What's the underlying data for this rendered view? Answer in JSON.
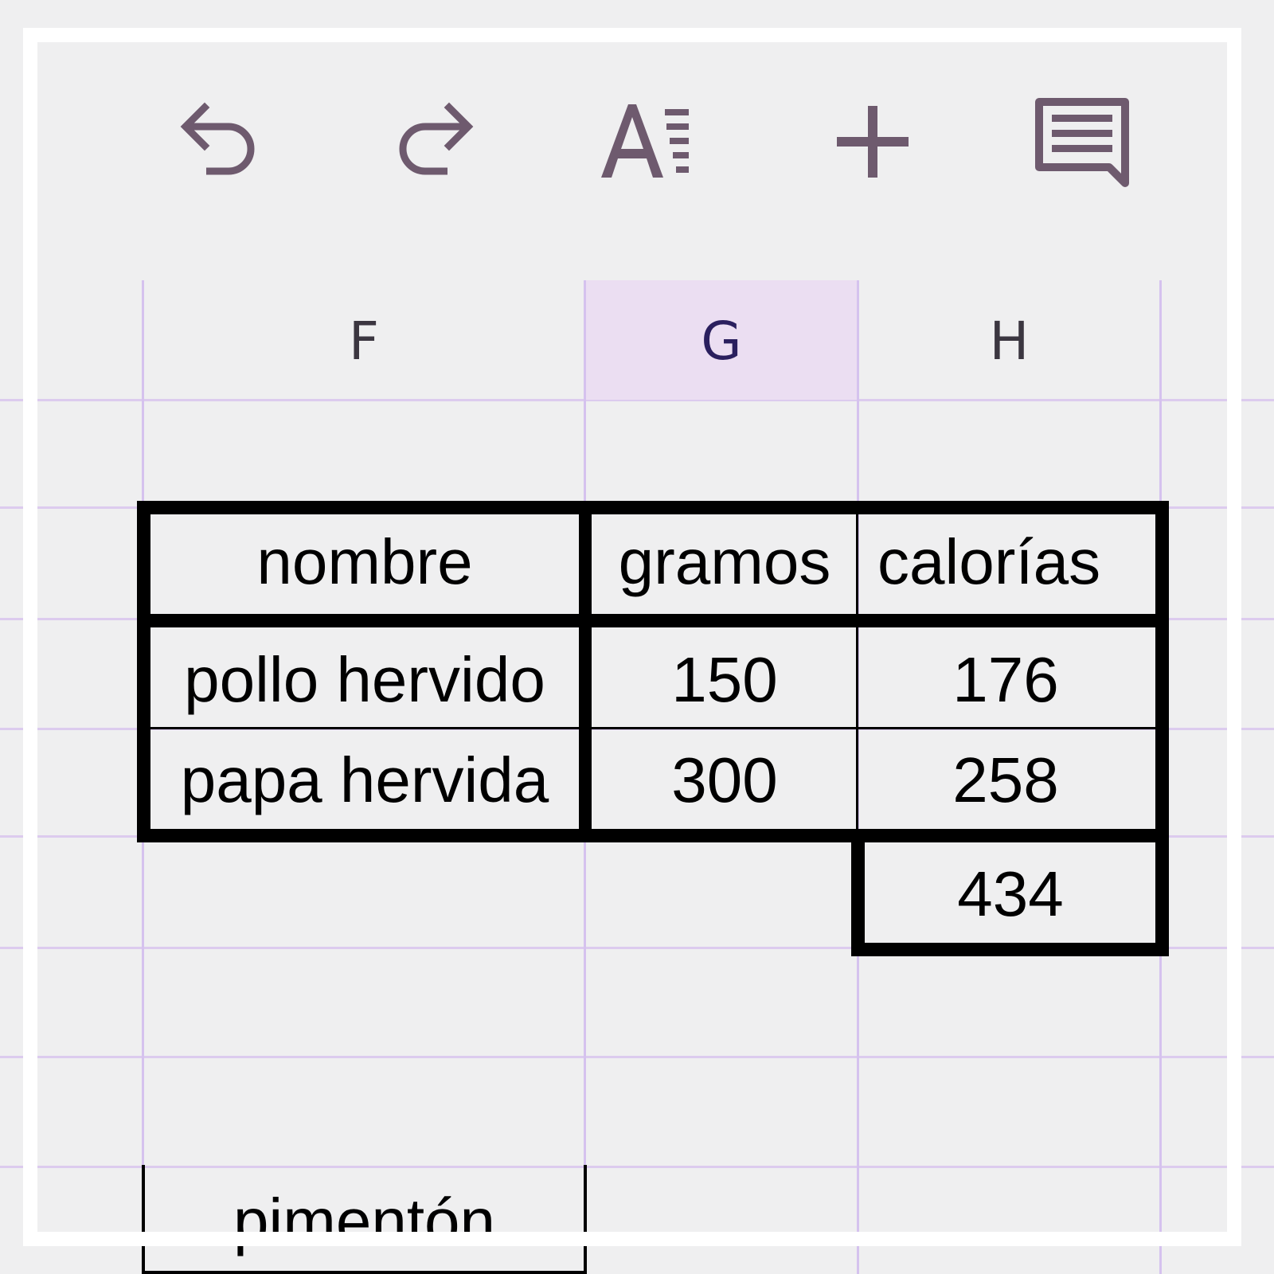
{
  "toolbar": {
    "undo_icon": "undo-icon",
    "redo_icon": "redo-icon",
    "text_format_icon": "text-format-icon",
    "insert_icon": "plus-icon",
    "comment_icon": "comment-icon",
    "icon_color": "#6e5a6e"
  },
  "columns": [
    {
      "label": "F",
      "selected": false
    },
    {
      "label": "G",
      "selected": true
    },
    {
      "label": "H",
      "selected": false
    }
  ],
  "table": {
    "headers": [
      "nombre",
      "gramos",
      "calorías"
    ],
    "rows": [
      [
        "pollo hervido",
        "150",
        "176"
      ],
      [
        "papa hervida",
        "300",
        "258"
      ]
    ],
    "total": "434"
  },
  "partial_cell": "pimentón",
  "colors": {
    "grid_line": "#dccbee",
    "selected_header": "#ebdef2",
    "background": "#efeff0"
  }
}
